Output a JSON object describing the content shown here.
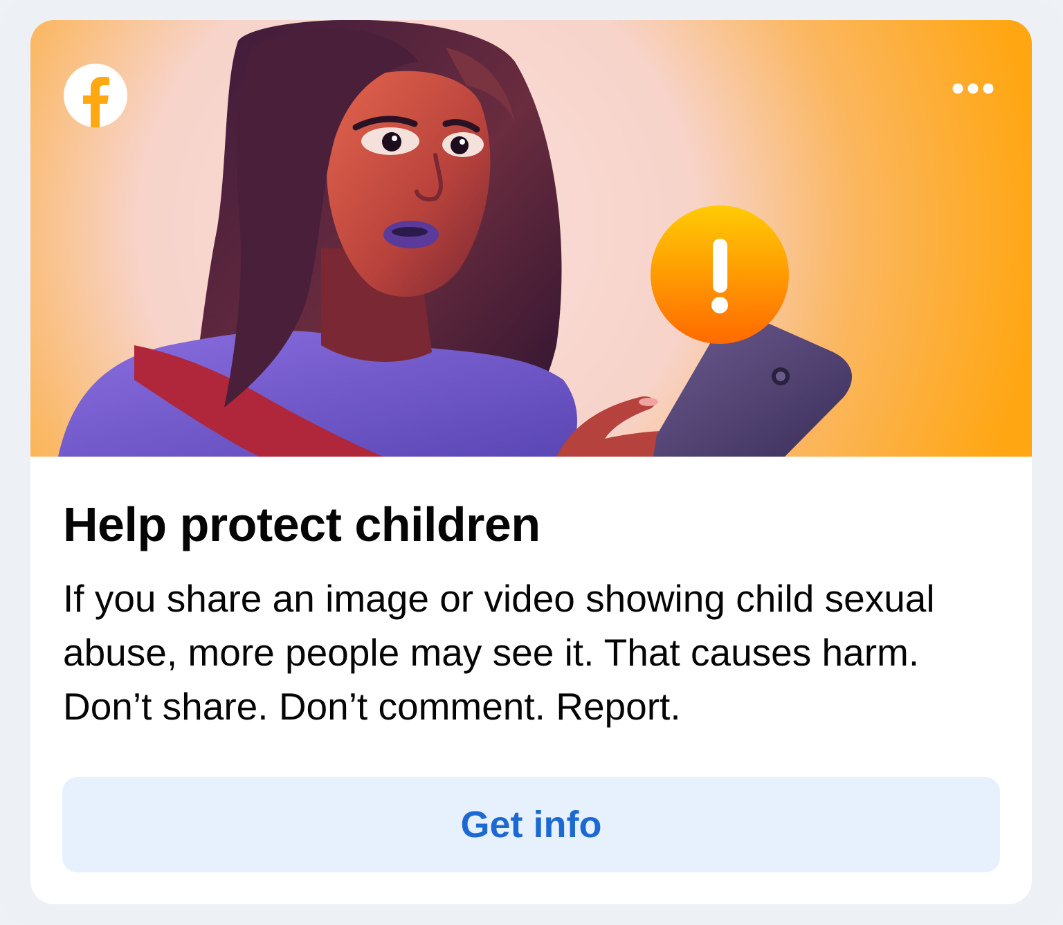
{
  "card": {
    "title": "Help protect children",
    "body": "If you share an image or video showing child sexual abuse, more people may see it. That causes harm. Don’t share. Don’t comment. Report.",
    "button_label": "Get info"
  },
  "header": {
    "logo_icon": "facebook-logo-icon",
    "more_icon": "more-options-icon"
  },
  "colors": {
    "hero_orange": "#ffa812",
    "hero_glow": "#f8dcd6",
    "button_bg": "#e6f1fd",
    "button_text": "#1c6ad1",
    "title_text": "#050505",
    "alert_orange": "#ff8a00"
  }
}
